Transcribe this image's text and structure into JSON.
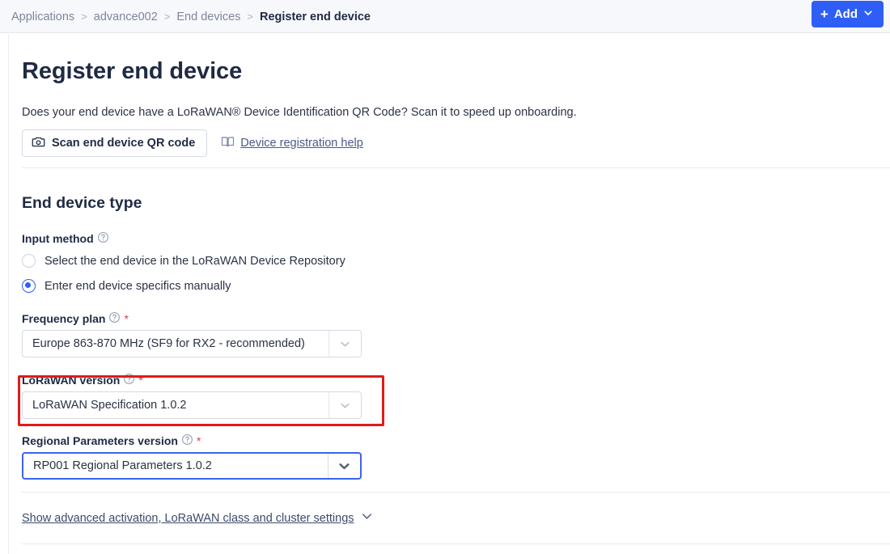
{
  "header": {
    "breadcrumb": [
      {
        "label": "Applications",
        "active": false
      },
      {
        "label": "advance002",
        "active": false
      },
      {
        "label": "End devices",
        "active": false
      },
      {
        "label": "Register end device",
        "active": true
      }
    ],
    "separator": ">",
    "add_button": {
      "label": "Add",
      "plus_icon": "plus-icon",
      "chevron_icon": "chevron-down-icon",
      "color": "#2f5ef6"
    }
  },
  "page": {
    "title": "Register end device",
    "description": "Does your end device have a LoRaWAN® Device Identification QR Code? Scan it to speed up onboarding.",
    "qr_button": {
      "label": "Scan end device QR code",
      "icon": "camera-icon"
    },
    "help_link": {
      "label": "Device registration help",
      "icon": "book-icon"
    }
  },
  "end_device_type": {
    "section_title": "End device type",
    "input_method": {
      "label": "Input method",
      "info_icon": "question-circle-icon",
      "options": [
        {
          "label": "Select the end device in the LoRaWAN Device Repository",
          "selected": false
        },
        {
          "label": "Enter end device specifics manually",
          "selected": true
        }
      ]
    },
    "frequency_plan": {
      "label": "Frequency plan",
      "info_icon": "question-circle-icon",
      "required_mark": "*",
      "value": "Europe 863-870 MHz (SF9 for RX2 - recommended)",
      "focused": false
    },
    "lorawan_version": {
      "label": "LoRaWAN version",
      "info_icon": "question-circle-icon",
      "required_mark": "*",
      "value": "LoRaWAN Specification 1.0.2",
      "focused": false,
      "highlighted": true,
      "highlight_color": "#e01b1b"
    },
    "regional_parameters_version": {
      "label": "Regional Parameters version",
      "info_icon": "question-circle-icon",
      "required_mark": "*",
      "value": "RP001 Regional Parameters 1.0.2",
      "focused": true,
      "focus_color": "#3b63f0"
    }
  },
  "advanced": {
    "label": "Show advanced activation, LoRaWAN class and cluster settings",
    "chevron_icon": "chevron-down-icon"
  }
}
